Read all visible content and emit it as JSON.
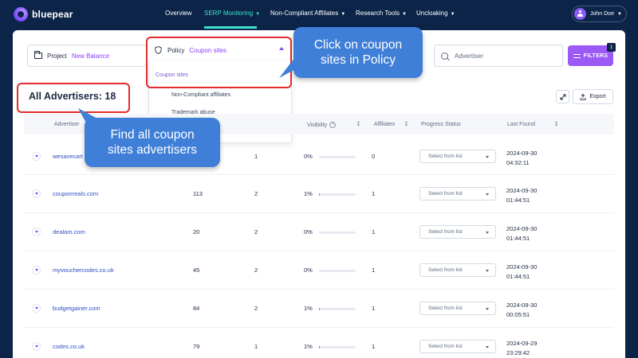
{
  "app": {
    "brand": "bluepear"
  },
  "nav": [
    {
      "label": "Overview",
      "caret": false
    },
    {
      "label": "SERP Monitoring",
      "caret": true,
      "active": true
    },
    {
      "label": "Non-Compliant Affiliates",
      "caret": true
    },
    {
      "label": "Research Tools",
      "caret": true
    },
    {
      "label": "Uncloaking",
      "caret": true
    }
  ],
  "user": {
    "name": "John Doe"
  },
  "filters": {
    "project_label": "Project",
    "project_value": "New Balance",
    "policy_label": "Policy",
    "policy_value": "Coupon sites",
    "policy_options": [
      "Coupon sites",
      "Non-Compliant affiliates",
      "Trademark abuse"
    ],
    "advertiser_placeholder": "Advertiser",
    "filters_button": "FILTERS",
    "filters_count": "1"
  },
  "heading": "All Advertisers: 18",
  "toolbar": {
    "export_label": "Export"
  },
  "table": {
    "columns": [
      "Advertiser",
      "Visibility",
      "Affiliates",
      "Progress Status",
      "Last Found"
    ],
    "select_placeholder": "Select from list",
    "rows": [
      {
        "advertiser": "wesavecart",
        "c2": "",
        "c3": "1",
        "visibility": "0%",
        "visibility_fraction": 0,
        "affiliates": "0",
        "date": "2024-09-30",
        "time": "04:32:11"
      },
      {
        "advertiser": "couponreals.com",
        "c2": "113",
        "c3": "2",
        "visibility": "1%",
        "visibility_fraction": 0.01,
        "affiliates": "1",
        "date": "2024-09-30",
        "time": "01:44:51"
      },
      {
        "advertiser": "dealam.com",
        "c2": "20",
        "c3": "2",
        "visibility": "0%",
        "visibility_fraction": 0,
        "affiliates": "1",
        "date": "2024-09-30",
        "time": "01:44:51"
      },
      {
        "advertiser": "myvouchercodes.co.uk",
        "c2": "45",
        "c3": "2",
        "visibility": "0%",
        "visibility_fraction": 0,
        "affiliates": "1",
        "date": "2024-09-30",
        "time": "01:44:51"
      },
      {
        "advertiser": "budgetgainer.com",
        "c2": "84",
        "c3": "2",
        "visibility": "1%",
        "visibility_fraction": 0.01,
        "affiliates": "1",
        "date": "2024-09-30",
        "time": "00:05:51"
      },
      {
        "advertiser": "codes.co.uk",
        "c2": "79",
        "c3": "1",
        "visibility": "1%",
        "visibility_fraction": 0.01,
        "affiliates": "1",
        "date": "2024-09-29",
        "time": "23:29:42"
      }
    ]
  },
  "callouts": {
    "policy": [
      "Click on coupon",
      "sites in Policy"
    ],
    "advertisers": [
      "Find all coupon",
      "sites advertisers"
    ]
  },
  "colors": {
    "nav_bg": "#0b2447",
    "accent": "#9b59f6",
    "active_nav": "#3ee0d0",
    "callout": "#3f7fd8",
    "highlight": "#e52b2b"
  }
}
